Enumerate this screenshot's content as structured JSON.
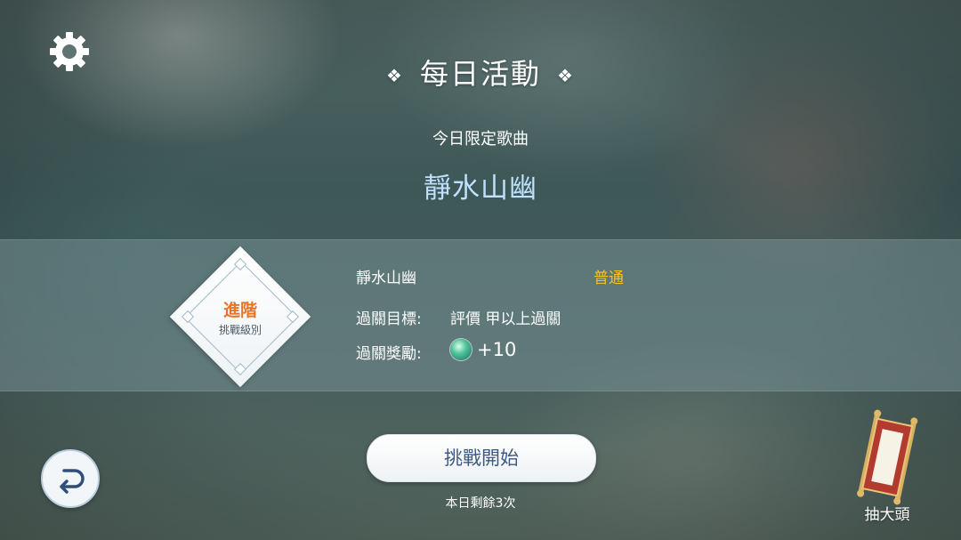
{
  "header": {
    "title": "每日活動",
    "ornament": "❖"
  },
  "icons": {
    "settings": "gear-icon",
    "back": "return-arrow-icon",
    "gacha": "scroll-icon",
    "reward": "jade-coin-icon"
  },
  "today": {
    "subtitle": "今日限定歌曲",
    "song_title": "靜水山幽"
  },
  "challenge": {
    "level_name": "進階",
    "level_caption": "挑戰級別",
    "song_name": "靜水山幽",
    "difficulty": "普通",
    "goal_label": "過關目標:",
    "goal_value": "評價 甲以上過關",
    "reward_label": "過關獎勵:",
    "reward_value": "+10"
  },
  "actions": {
    "start_label": "挑戰開始",
    "remaining_text": "本日剩餘3次",
    "gacha_label": "抽大頭"
  },
  "colors": {
    "song_title": "#bfe1ff",
    "level_name": "#e8742a",
    "difficulty": "#f5c422",
    "start_text": "#3b5a85"
  }
}
